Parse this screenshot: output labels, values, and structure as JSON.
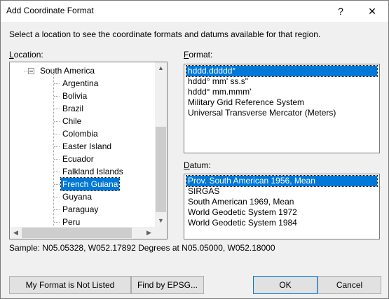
{
  "window": {
    "title": "Add Coordinate Format",
    "help_glyph": "?",
    "close_glyph": "✕"
  },
  "instructions": "Select a location to see the coordinate formats and datums available for that region.",
  "location": {
    "label_prefix": "",
    "label_accel": "L",
    "label_rest": "ocation:",
    "parent": "South America",
    "items": [
      "Argentina",
      "Bolivia",
      "Brazil",
      "Chile",
      "Colombia",
      "Easter Island",
      "Ecuador",
      "Falkland Islands",
      "French Guiana",
      "Guyana",
      "Paraguay",
      "Peru"
    ],
    "selected": "French Guiana"
  },
  "format": {
    "label_accel": "F",
    "label_rest": "ormat:",
    "items": [
      "hddd.ddddd°",
      "hddd° mm' ss.s\"",
      "hddd° mm.mmm'",
      "Military Grid Reference System",
      "Universal Transverse Mercator (Meters)"
    ],
    "selected": "hddd.ddddd°"
  },
  "datum": {
    "label_accel": "D",
    "label_rest": "atum:",
    "items": [
      "Prov. South American 1956, Mean",
      "SIRGAS",
      "South American 1969, Mean",
      "World Geodetic System 1972",
      "World Geodetic System 1984"
    ],
    "selected": "Prov. South American 1956, Mean"
  },
  "sample": "Sample: N05.05328, W052.17892 Degrees at N05.05000, W052.18000",
  "buttons": {
    "not_listed": "My Format is Not Listed",
    "epsg": "Find by EPSG...",
    "ok": "OK",
    "cancel": "Cancel"
  },
  "colors": {
    "selection": "#0078d7",
    "dialog_bg": "#f0f0f0"
  }
}
